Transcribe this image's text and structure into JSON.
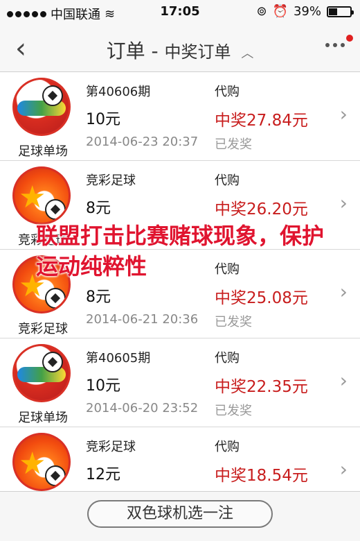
{
  "status_bar": {
    "carrier": "中国联通",
    "time": "17:05",
    "battery": "39%"
  },
  "nav": {
    "title": "订单",
    "separator": "-",
    "subtitle": "中奖订单"
  },
  "orders": [
    {
      "logo": "足球单场",
      "issue": "第40606期",
      "amount": "10元",
      "date": "2014-06-23 20:37",
      "type": "代购",
      "prize": "中奖27.84元",
      "status": "已发奖"
    },
    {
      "logo": "竞彩足球",
      "issue": "竞彩足球",
      "amount": "8元",
      "date": "",
      "type": "代购",
      "prize": "中奖26.20元",
      "status": ""
    },
    {
      "logo": "竞彩足球",
      "issue": "",
      "amount": "8元",
      "date": "2014-06-21 20:36",
      "type": "代购",
      "prize": "中奖25.08元",
      "status": "已发奖"
    },
    {
      "logo": "足球单场",
      "issue": "第40605期",
      "amount": "10元",
      "date": "2014-06-20 23:52",
      "type": "代购",
      "prize": "中奖22.35元",
      "status": "已发奖"
    },
    {
      "logo": "",
      "issue": "竞彩足球",
      "amount": "12元",
      "date": "",
      "type": "代购",
      "prize": "中奖18.54元",
      "status": ""
    }
  ],
  "watermark": "联盟打击比赛赌球现象，保护运动纯粹性",
  "bottom_button": "双色球机选一注",
  "colors": {
    "prize": "#c81d1d",
    "watermark": "#e0142f"
  }
}
